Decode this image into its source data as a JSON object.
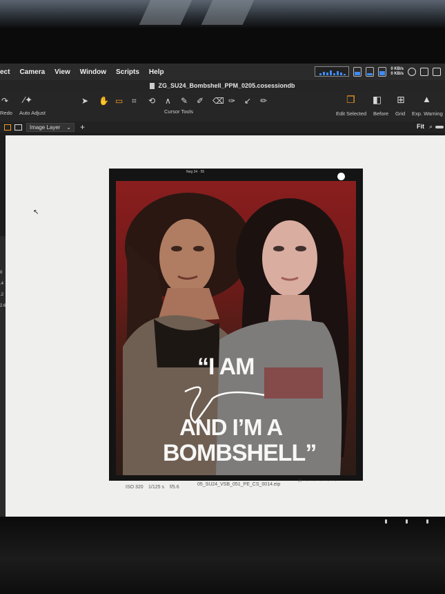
{
  "window": {
    "title": "ZG_SU24_Bombshell_PPM_0205.cosessiondb"
  },
  "menu": {
    "items": [
      "ect",
      "Camera",
      "View",
      "Window",
      "Scripts",
      "Help"
    ]
  },
  "status": {
    "net_up": "0 KB/s",
    "net_down": "0 KB/s"
  },
  "toolbar": {
    "redo_label": "Redo",
    "auto_adjust_label": "Auto Adjust",
    "cursor_tools_label": "Cursor Tools",
    "edit_selected_label": "Edit Selected",
    "before_label": "Before",
    "grid_label": "Grid",
    "exp_warning_label": "Exp. Warning"
  },
  "options": {
    "layer_select": "Image Layer",
    "zoom": "Fit"
  },
  "left_panel": {
    "numbers": [
      "0",
      ".4",
      ".2",
      "2.6"
    ]
  },
  "image": {
    "top_label": "Neg 34 · 55",
    "quote_line1": "“I AM",
    "quote_line2": "AND I’M A",
    "quote_line3": "BOMBSHELL”",
    "iso": "ISO 320",
    "shutter": "1/125 s",
    "aperture": "f/5.6",
    "filename": "05_SU24_VSB_051_PE_CS_0014.eip"
  },
  "colors": {
    "accent": "#f59a23",
    "background_red": "#8a1e1e"
  }
}
